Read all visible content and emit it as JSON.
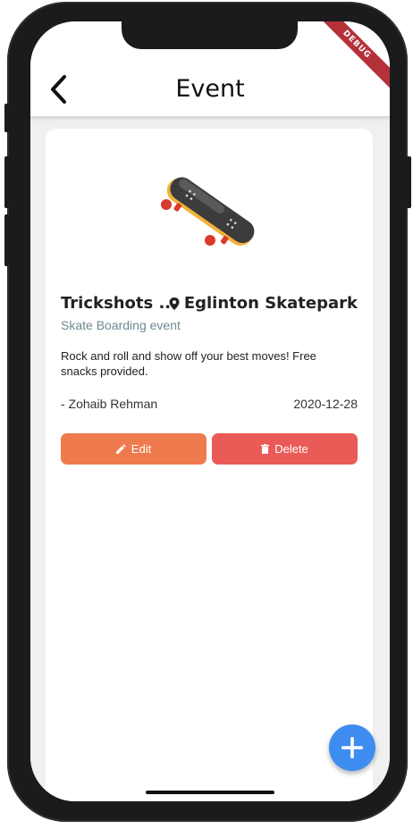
{
  "app_bar": {
    "title": "Event",
    "back_icon": "back-arrow-icon"
  },
  "debug_banner": "DEBUG",
  "event": {
    "image_icon": "skateboard-icon",
    "name": "Trickshots ...",
    "location": "Eglinton Skatepark",
    "location_icon": "location-pin-icon",
    "category": "Skate Boarding event",
    "description": "Rock and roll and show off your best moves! Free snacks provided.",
    "author": "- Zohaib Rehman",
    "date": "2020-12-28"
  },
  "actions": {
    "edit_label": "Edit",
    "edit_icon": "pencil-icon",
    "delete_label": "Delete",
    "delete_icon": "trash-icon"
  },
  "fab": {
    "icon": "plus-icon"
  },
  "colors": {
    "edit": "#ef7a4d",
    "delete": "#ea5b58",
    "fab": "#3e8cf0",
    "subtitle": "#6f8894",
    "background": "#f0f0f0"
  }
}
